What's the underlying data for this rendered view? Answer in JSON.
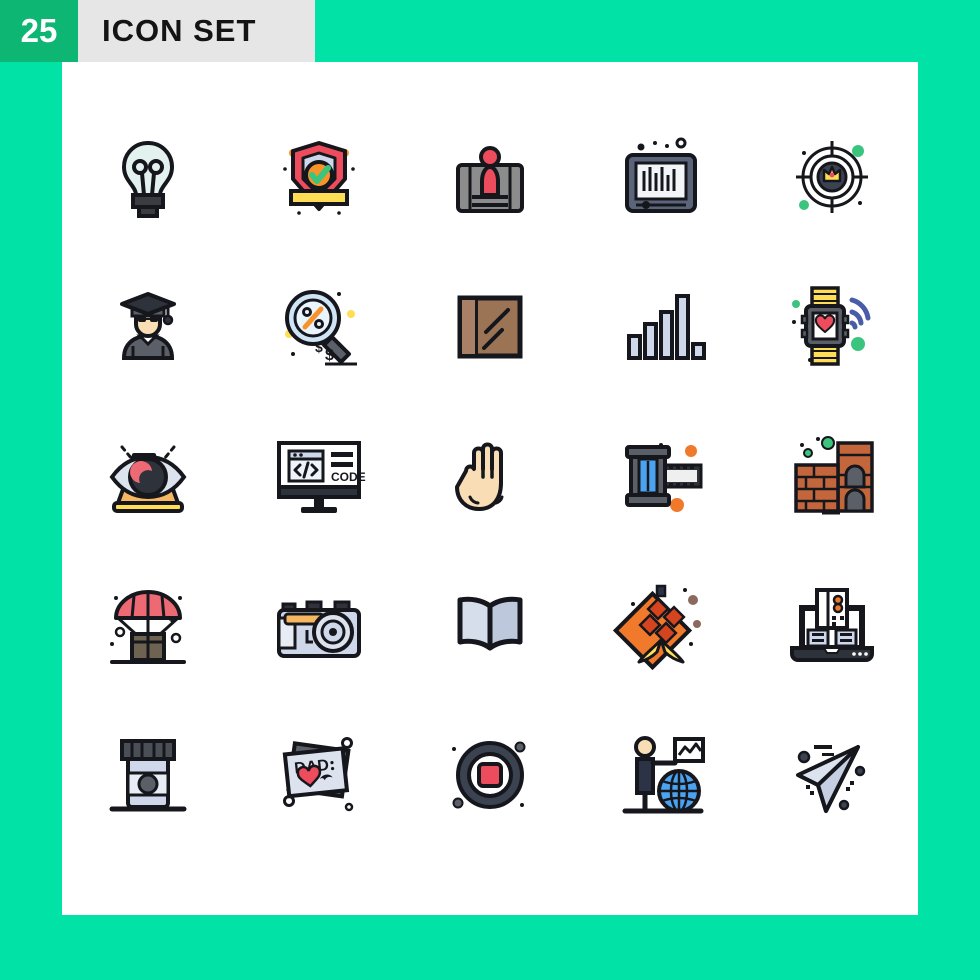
{
  "header": {
    "count": "25",
    "title": "ICON SET"
  },
  "colors": {
    "background": "#00E2A6",
    "badge": "#0DB673",
    "header_bar": "#E6E6E6",
    "panel": "#FFFFFF",
    "outline": "#16161d",
    "red": "#ED4C5C",
    "orange": "#F79329",
    "yellow": "#FFDD55",
    "green": "#3BC47E",
    "blue": "#4BA3F0",
    "light_blue": "#CFD8EA",
    "gray": "#8C8C8C",
    "brown": "#A0785A",
    "skin": "#F9DDB4"
  },
  "panel": {
    "columns": 5,
    "rows": 5,
    "total_icons": 25
  },
  "icons": [
    {
      "name": "light-bulb-icon",
      "label": "Light Bulb",
      "row": 1,
      "col": 1
    },
    {
      "name": "security-shield-icon",
      "label": "Security Shield Check",
      "row": 1,
      "col": 2
    },
    {
      "name": "profile-card-icon",
      "label": "User Profile Card",
      "row": 1,
      "col": 3
    },
    {
      "name": "tablet-barcode-icon",
      "label": "Tablet Barcode",
      "row": 1,
      "col": 4
    },
    {
      "name": "target-crown-icon",
      "label": "Target Crown",
      "row": 1,
      "col": 5
    },
    {
      "name": "graduate-icon",
      "label": "Graduate Student",
      "row": 2,
      "col": 1
    },
    {
      "name": "search-discount-icon",
      "label": "Search Discount",
      "row": 2,
      "col": 2
    },
    {
      "name": "wooden-board-icon",
      "label": "Wooden Board",
      "row": 2,
      "col": 3
    },
    {
      "name": "bar-chart-icon",
      "label": "Bar Chart Signal",
      "row": 2,
      "col": 4
    },
    {
      "name": "smartwatch-heart-icon",
      "label": "Smartwatch Heart Wifi",
      "row": 2,
      "col": 5
    },
    {
      "name": "eye-vision-icon",
      "label": "Eye Vision",
      "row": 3,
      "col": 1
    },
    {
      "name": "code-monitor-icon",
      "label": "Code Monitor",
      "row": 3,
      "col": 2
    },
    {
      "name": "hand-gesture-icon",
      "label": "Hand Gesture",
      "row": 3,
      "col": 3
    },
    {
      "name": "film-roll-icon",
      "label": "Film Roll",
      "row": 3,
      "col": 4
    },
    {
      "name": "brick-building-icon",
      "label": "Brick Building",
      "row": 3,
      "col": 5
    },
    {
      "name": "parachute-delivery-icon",
      "label": "Parachute Delivery",
      "row": 4,
      "col": 1
    },
    {
      "name": "camera-icon",
      "label": "Camera",
      "row": 4,
      "col": 2
    },
    {
      "name": "open-book-icon",
      "label": "Open Book",
      "row": 4,
      "col": 3
    },
    {
      "name": "ketupat-kite-icon",
      "label": "Ketupat Kite",
      "row": 4,
      "col": 4
    },
    {
      "name": "laptop-server-icon",
      "label": "Laptop Server",
      "row": 4,
      "col": 5
    },
    {
      "name": "jar-bottle-icon",
      "label": "Jar Bottle",
      "row": 5,
      "col": 1
    },
    {
      "name": "dad-card-icon",
      "label": "Dad Greeting Card",
      "row": 5,
      "col": 2
    },
    {
      "name": "record-stop-icon",
      "label": "Record Stop Button",
      "row": 5,
      "col": 3
    },
    {
      "name": "presenter-globe-icon",
      "label": "Presenter Globe",
      "row": 5,
      "col": 4
    },
    {
      "name": "paper-plane-icon",
      "label": "Paper Plane Send",
      "row": 5,
      "col": 5
    }
  ],
  "icon_text": {
    "code_monitor_label": "CODE",
    "dad_card_label": "DAD",
    "search_discount_symbol": "%",
    "search_discount_currency": "$"
  }
}
